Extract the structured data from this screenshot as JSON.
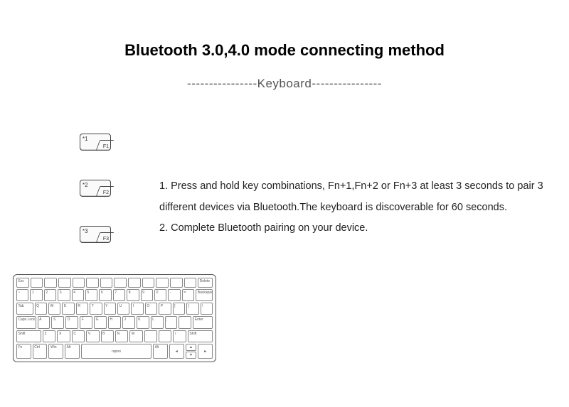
{
  "title": "Bluetooth 3.0,4.0 mode connecting method",
  "subtitle": "----------------Keyboard----------------",
  "keycaps": {
    "k1_num": "*1",
    "k1_fn": "F1",
    "k2_num": "*2",
    "k2_fn": "F2",
    "k3_num": "*3",
    "k3_fn": "F3"
  },
  "instructions": {
    "line1": "1. Press and hold key combinations, Fn+1,Fn+2 or Fn+3 at least 3 seconds to pair 3 different devices via Bluetooth.The keyboard is discoverable for 60 seconds.",
    "line2": "2. Complete Bluetooth pairing on your device."
  },
  "keyboard": {
    "row0": [
      "Esc",
      "",
      "",
      "",
      "",
      "",
      "",
      "",
      "",
      "",
      "",
      "",
      "",
      "Delete"
    ],
    "row1": [
      "~",
      "1",
      "2",
      "3",
      "4",
      "5",
      "6",
      "7",
      "8",
      "9",
      "0",
      "-",
      "=",
      "Backspace"
    ],
    "row2": [
      "Tab",
      "Q",
      "W",
      "E",
      "R",
      "T",
      "Y",
      "U",
      "I",
      "O",
      "P",
      "[",
      "]",
      "\\"
    ],
    "row3": [
      "Caps Lock",
      "A",
      "S",
      "D",
      "F",
      "G",
      "H",
      "J",
      "K",
      "L",
      ";",
      "'",
      "Enter"
    ],
    "row4": [
      "Shift",
      "Z",
      "X",
      "C",
      "V",
      "B",
      "N",
      "M",
      ",",
      ".",
      "/",
      "Shift"
    ],
    "row5": [
      "Fn",
      "Ctrl",
      "Win",
      "Alt",
      "",
      "rapoo",
      "Alt",
      "◄",
      "▲▼",
      "►"
    ],
    "brand": "rapoo"
  }
}
